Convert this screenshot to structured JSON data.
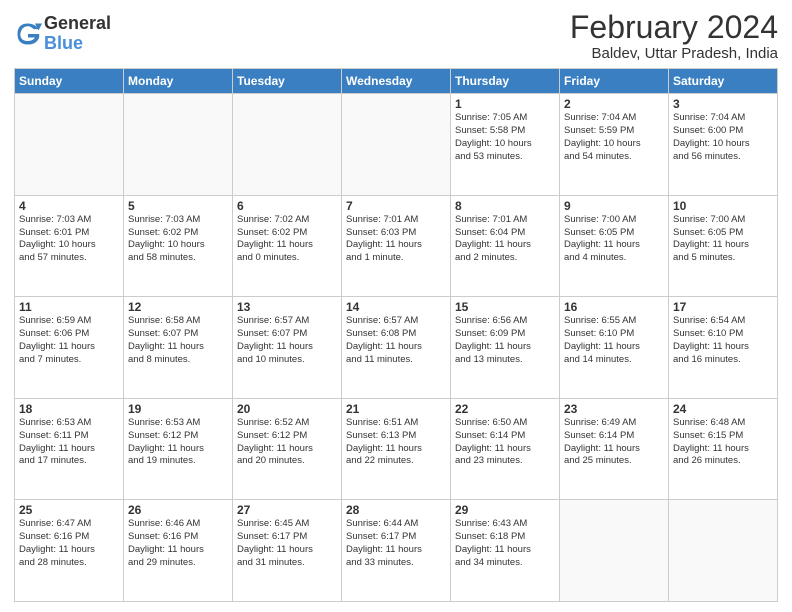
{
  "logo": {
    "general": "General",
    "blue": "Blue"
  },
  "title": {
    "month_year": "February 2024",
    "location": "Baldev, Uttar Pradesh, India"
  },
  "headers": [
    "Sunday",
    "Monday",
    "Tuesday",
    "Wednesday",
    "Thursday",
    "Friday",
    "Saturday"
  ],
  "weeks": [
    [
      {
        "day": "",
        "info": ""
      },
      {
        "day": "",
        "info": ""
      },
      {
        "day": "",
        "info": ""
      },
      {
        "day": "",
        "info": ""
      },
      {
        "day": "1",
        "info": "Sunrise: 7:05 AM\nSunset: 5:58 PM\nDaylight: 10 hours\nand 53 minutes."
      },
      {
        "day": "2",
        "info": "Sunrise: 7:04 AM\nSunset: 5:59 PM\nDaylight: 10 hours\nand 54 minutes."
      },
      {
        "day": "3",
        "info": "Sunrise: 7:04 AM\nSunset: 6:00 PM\nDaylight: 10 hours\nand 56 minutes."
      }
    ],
    [
      {
        "day": "4",
        "info": "Sunrise: 7:03 AM\nSunset: 6:01 PM\nDaylight: 10 hours\nand 57 minutes."
      },
      {
        "day": "5",
        "info": "Sunrise: 7:03 AM\nSunset: 6:02 PM\nDaylight: 10 hours\nand 58 minutes."
      },
      {
        "day": "6",
        "info": "Sunrise: 7:02 AM\nSunset: 6:02 PM\nDaylight: 11 hours\nand 0 minutes."
      },
      {
        "day": "7",
        "info": "Sunrise: 7:01 AM\nSunset: 6:03 PM\nDaylight: 11 hours\nand 1 minute."
      },
      {
        "day": "8",
        "info": "Sunrise: 7:01 AM\nSunset: 6:04 PM\nDaylight: 11 hours\nand 2 minutes."
      },
      {
        "day": "9",
        "info": "Sunrise: 7:00 AM\nSunset: 6:05 PM\nDaylight: 11 hours\nand 4 minutes."
      },
      {
        "day": "10",
        "info": "Sunrise: 7:00 AM\nSunset: 6:05 PM\nDaylight: 11 hours\nand 5 minutes."
      }
    ],
    [
      {
        "day": "11",
        "info": "Sunrise: 6:59 AM\nSunset: 6:06 PM\nDaylight: 11 hours\nand 7 minutes."
      },
      {
        "day": "12",
        "info": "Sunrise: 6:58 AM\nSunset: 6:07 PM\nDaylight: 11 hours\nand 8 minutes."
      },
      {
        "day": "13",
        "info": "Sunrise: 6:57 AM\nSunset: 6:07 PM\nDaylight: 11 hours\nand 10 minutes."
      },
      {
        "day": "14",
        "info": "Sunrise: 6:57 AM\nSunset: 6:08 PM\nDaylight: 11 hours\nand 11 minutes."
      },
      {
        "day": "15",
        "info": "Sunrise: 6:56 AM\nSunset: 6:09 PM\nDaylight: 11 hours\nand 13 minutes."
      },
      {
        "day": "16",
        "info": "Sunrise: 6:55 AM\nSunset: 6:10 PM\nDaylight: 11 hours\nand 14 minutes."
      },
      {
        "day": "17",
        "info": "Sunrise: 6:54 AM\nSunset: 6:10 PM\nDaylight: 11 hours\nand 16 minutes."
      }
    ],
    [
      {
        "day": "18",
        "info": "Sunrise: 6:53 AM\nSunset: 6:11 PM\nDaylight: 11 hours\nand 17 minutes."
      },
      {
        "day": "19",
        "info": "Sunrise: 6:53 AM\nSunset: 6:12 PM\nDaylight: 11 hours\nand 19 minutes."
      },
      {
        "day": "20",
        "info": "Sunrise: 6:52 AM\nSunset: 6:12 PM\nDaylight: 11 hours\nand 20 minutes."
      },
      {
        "day": "21",
        "info": "Sunrise: 6:51 AM\nSunset: 6:13 PM\nDaylight: 11 hours\nand 22 minutes."
      },
      {
        "day": "22",
        "info": "Sunrise: 6:50 AM\nSunset: 6:14 PM\nDaylight: 11 hours\nand 23 minutes."
      },
      {
        "day": "23",
        "info": "Sunrise: 6:49 AM\nSunset: 6:14 PM\nDaylight: 11 hours\nand 25 minutes."
      },
      {
        "day": "24",
        "info": "Sunrise: 6:48 AM\nSunset: 6:15 PM\nDaylight: 11 hours\nand 26 minutes."
      }
    ],
    [
      {
        "day": "25",
        "info": "Sunrise: 6:47 AM\nSunset: 6:16 PM\nDaylight: 11 hours\nand 28 minutes."
      },
      {
        "day": "26",
        "info": "Sunrise: 6:46 AM\nSunset: 6:16 PM\nDaylight: 11 hours\nand 29 minutes."
      },
      {
        "day": "27",
        "info": "Sunrise: 6:45 AM\nSunset: 6:17 PM\nDaylight: 11 hours\nand 31 minutes."
      },
      {
        "day": "28",
        "info": "Sunrise: 6:44 AM\nSunset: 6:17 PM\nDaylight: 11 hours\nand 33 minutes."
      },
      {
        "day": "29",
        "info": "Sunrise: 6:43 AM\nSunset: 6:18 PM\nDaylight: 11 hours\nand 34 minutes."
      },
      {
        "day": "",
        "info": ""
      },
      {
        "day": "",
        "info": ""
      }
    ]
  ]
}
